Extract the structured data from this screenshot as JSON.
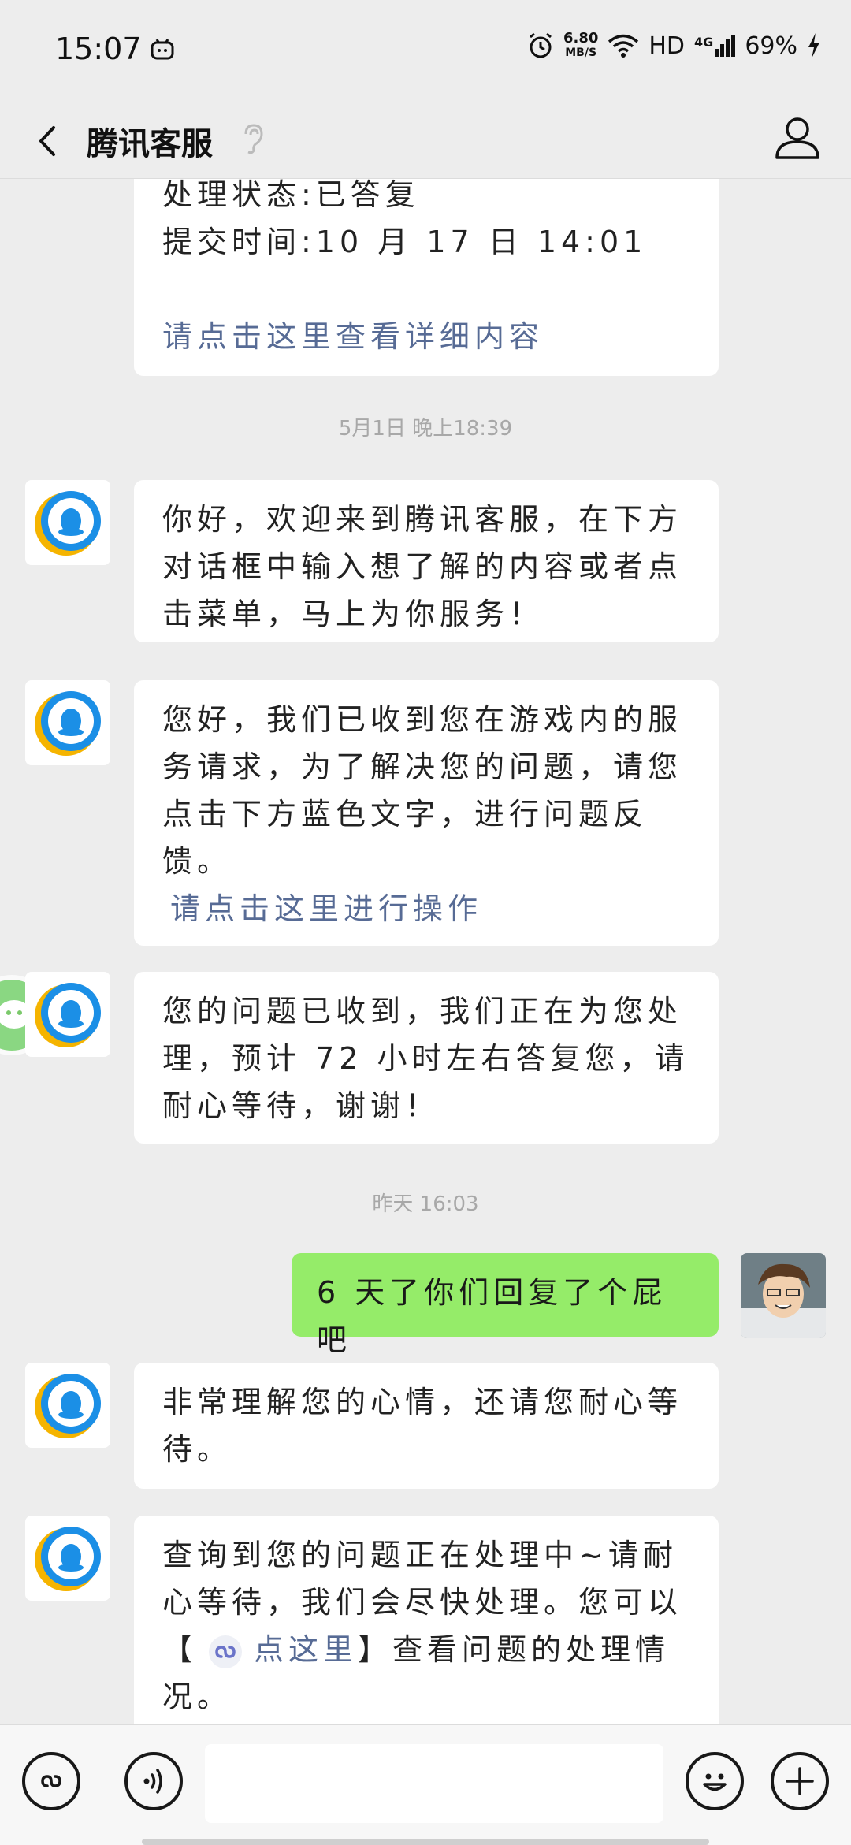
{
  "status_bar": {
    "time": "15:07",
    "speed_value": "6.80",
    "speed_unit": "MB/S",
    "hd": "HD",
    "network": "4G",
    "battery": "69%",
    "icons": [
      "alarm-icon",
      "wifi-icon",
      "signal-icon",
      "charging-icon"
    ]
  },
  "nav": {
    "title": "腾讯客服",
    "icons": [
      "back-icon",
      "ear-icon",
      "profile-icon"
    ]
  },
  "messages": {
    "top_partial": {
      "line1": "处理状态:已答复",
      "line2": "提交时间:10 月 17 日 14:01",
      "link": "请点击这里查看详细内容"
    },
    "timestamp1": "5月1日 晚上18:39",
    "msg1": "你好，欢迎来到腾讯客服，在下方对话框中输入想了解的内容或者点击菜单，马上为你服务！",
    "msg2_text": "您好，我们已收到您在游戏内的服务请求，为了解决您的问题，请您点击下方蓝色文字，进行问题反馈。",
    "msg2_link": "请点击这里进行操作",
    "msg3": "您的问题已收到，我们正在为您处理，预计 72 小时左右答复您，请耐心等待，谢谢！",
    "timestamp2": "昨天 16:03",
    "my_msg": "6 天了你们回复了个屁吧",
    "msg4": "非常理解您的心情，还请您耐心等待。",
    "msg5_text_a": "查询到您的问题正在处理中~请耐心等待，我们会尽快处理。您可以【",
    "msg5_link": "点这里",
    "msg5_text_b": "】查看问题的处理情况。"
  },
  "bottom_bar": {
    "icons": [
      "mini-program-icon",
      "voice-icon",
      "emoji-icon",
      "plus-icon"
    ],
    "input_value": ""
  },
  "colors": {
    "background": "#ededed",
    "my_bubble": "#95ec69",
    "link": "#576b95",
    "qq_blue": "#1b8fe6",
    "qq_yellow": "#f5b400"
  }
}
